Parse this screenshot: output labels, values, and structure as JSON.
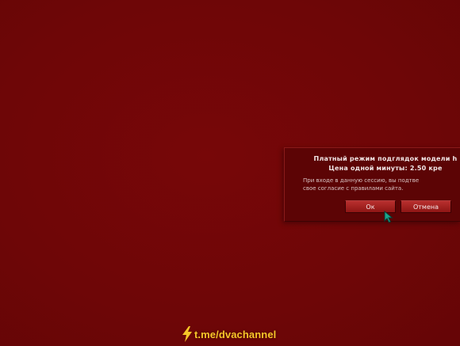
{
  "dialog": {
    "title_line1": "Платный режим подглядок модели h",
    "title_line2": "Цена одной минуты: 2.50 кре",
    "body_line1": "При входе в данную сессию, вы подтве",
    "body_line2": "свое согласие с правилами сайта.",
    "ok_label": "Ок",
    "cancel_label": "Отмена"
  },
  "watermark": {
    "text": "t.me/dvachannel",
    "icon": "lightning-bolt-icon"
  },
  "colors": {
    "background": "#6f0607",
    "dialog_background": "#5c0405",
    "button": "#a52221",
    "watermark": "#f6c629"
  }
}
